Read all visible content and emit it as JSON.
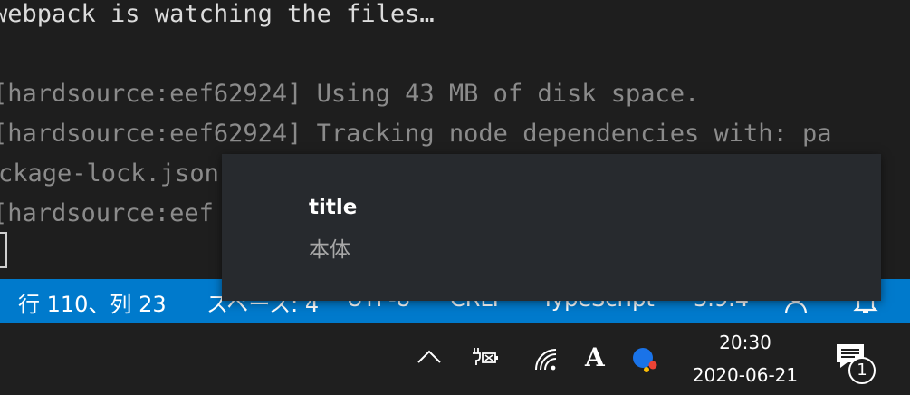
{
  "terminal": {
    "lines": [
      "webpack is watching the files…",
      "",
      "[hardsource:eef62924] Using 43 MB of disk space.",
      "[hardsource:eef62924] Tracking node dependencies with: pa",
      "ckage-lock.json",
      "[hardsource:eef"
    ]
  },
  "toast": {
    "title": "title",
    "body": "本体"
  },
  "statusbar": {
    "position": "行 110、列 23",
    "indent": "スペース: 4",
    "encoding": "UTF-8",
    "eol": "CRLF",
    "language": "TypeScript",
    "version": "3.9.4",
    "icons": [
      "person-icon",
      "bell-icon"
    ]
  },
  "taskbar": {
    "icons": [
      "chevron-up-icon",
      "battery-icon",
      "wifi-icon",
      "ime-icon",
      "app-icon",
      "notification-center-icon"
    ],
    "ime_label": "A",
    "time": "20:30",
    "date": "2020-06-21",
    "notification_count": "1"
  },
  "colors": {
    "statusbar": "#007acc",
    "terminal_bg": "#1e1e1e",
    "toast_bg": "#272a2e",
    "taskbar_bg": "#1f1f1f"
  }
}
